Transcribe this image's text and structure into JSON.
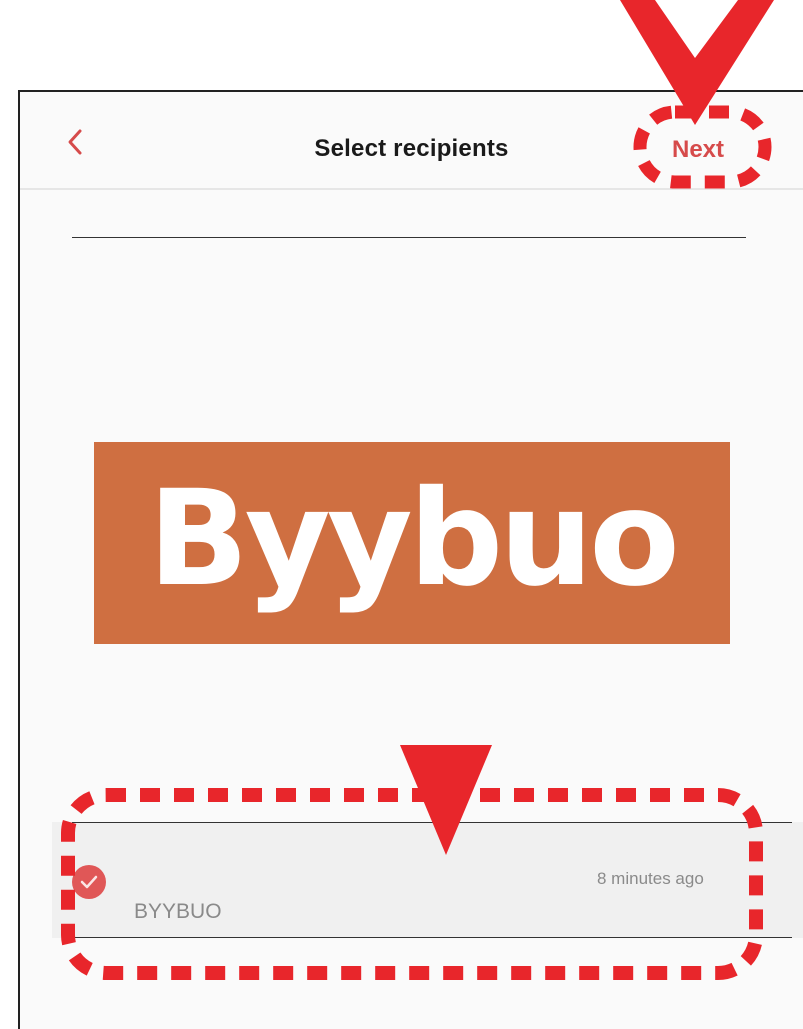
{
  "header": {
    "title": "Select recipients",
    "next_label": "Next"
  },
  "logo": {
    "text": "Byybuo",
    "color": "#cf6f41"
  },
  "recipients": [
    {
      "name": "BYYBUO",
      "time": "8 minutes ago",
      "selected": true
    }
  ],
  "icons": {
    "back": "chevron-left-icon",
    "selected": "checkmark-circle-icon",
    "annotation_arrow": "down-arrow-annotation",
    "annotation_highlight": "dashed-outline-annotation"
  },
  "colors": {
    "accent": "#d64b4b",
    "annotation": "#e8262b",
    "row_background": "#f0f0f0"
  }
}
